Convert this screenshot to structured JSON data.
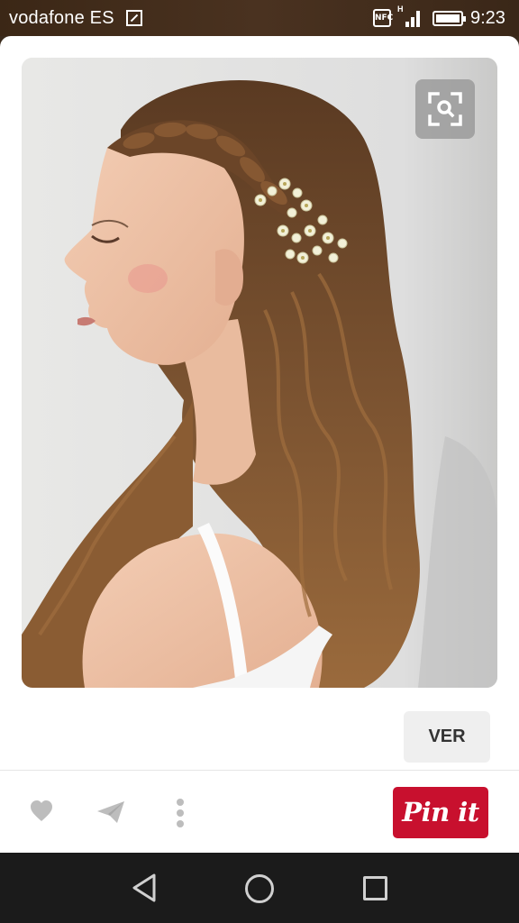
{
  "status_bar": {
    "carrier": "vodafone ES",
    "time": "9:23",
    "nfc_label": "NFC",
    "network_label": "H",
    "icons": [
      "sim-icon",
      "nfc-icon",
      "signal-icon",
      "battery-icon"
    ]
  },
  "pin": {
    "image_subject": "bride-hairstyle-photo",
    "visual_search_icon": "visual-search-icon",
    "visit_label": "VER"
  },
  "actions": {
    "icons": [
      "heart-icon",
      "send-icon",
      "more-vertical-icon"
    ],
    "pin_label": "Pin it",
    "pin_color": "#c8102e"
  },
  "nav_bar": {
    "icons": [
      "back-icon",
      "home-icon",
      "recents-icon"
    ]
  },
  "colors": {
    "status_bar": "#3b2716",
    "accent": "#c8102e",
    "nav_bar": "#1b1b1b"
  }
}
